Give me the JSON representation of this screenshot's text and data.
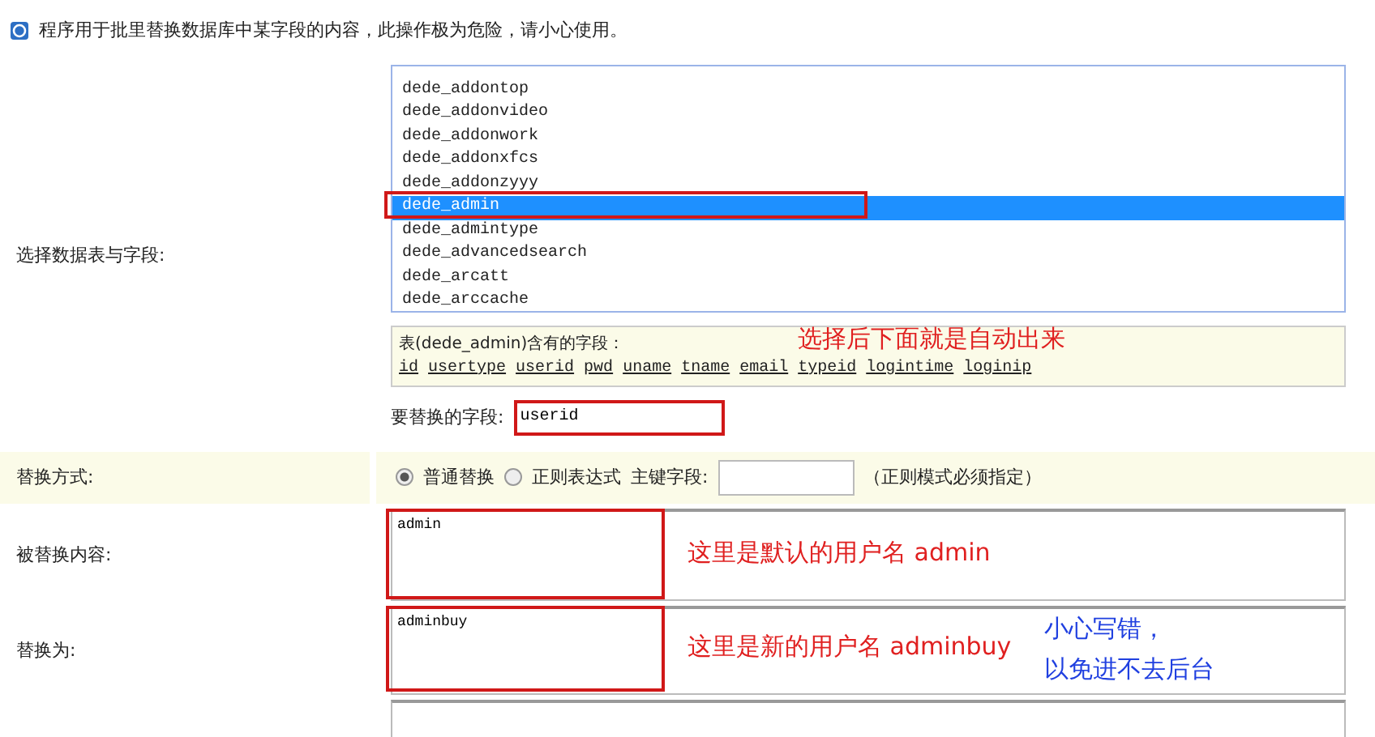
{
  "notice": "程序用于批里替换数据库中某字段的内容，此操作极为危险，请小心使用。",
  "table_select": {
    "label": "选择数据表与字段:",
    "tables": [
      {
        "name": "dede_addontop",
        "selected": false
      },
      {
        "name": "dede_addonvideo",
        "selected": false
      },
      {
        "name": "dede_addonwork",
        "selected": false
      },
      {
        "name": "dede_addonxfcs",
        "selected": false
      },
      {
        "name": "dede_addonzyyy",
        "selected": false
      },
      {
        "name": "dede_admin",
        "selected": true
      },
      {
        "name": "dede_admintype",
        "selected": false
      },
      {
        "name": "dede_advancedsearch",
        "selected": false
      },
      {
        "name": "dede_arcatt",
        "selected": false
      },
      {
        "name": "dede_arccache",
        "selected": false
      }
    ],
    "fields_title": "表(dede_admin)含有的字段：",
    "fields": [
      "id",
      "usertype",
      "userid",
      "pwd",
      "uname",
      "tname",
      "email",
      "typeid",
      "logintime",
      "loginip"
    ],
    "annotation": "选择后下面就是自动出来",
    "field_label": "要替换的字段:",
    "field_value": "userid"
  },
  "mode": {
    "label": "替换方式:",
    "options": [
      {
        "label": "普通替换",
        "selected": true
      },
      {
        "label": "正则表达式",
        "selected": false
      }
    ],
    "key_label": "主键字段:",
    "hint": "（正则模式必须指定）"
  },
  "find": {
    "label": "被替换内容:",
    "value": "admin",
    "annotation": "这里是默认的用户名 admin"
  },
  "replace": {
    "label": "替换为:",
    "value": "adminbuy",
    "annotation": "这里是新的用户名 adminbuy",
    "warning": [
      "小心写错，",
      "以免进不去后台"
    ]
  }
}
